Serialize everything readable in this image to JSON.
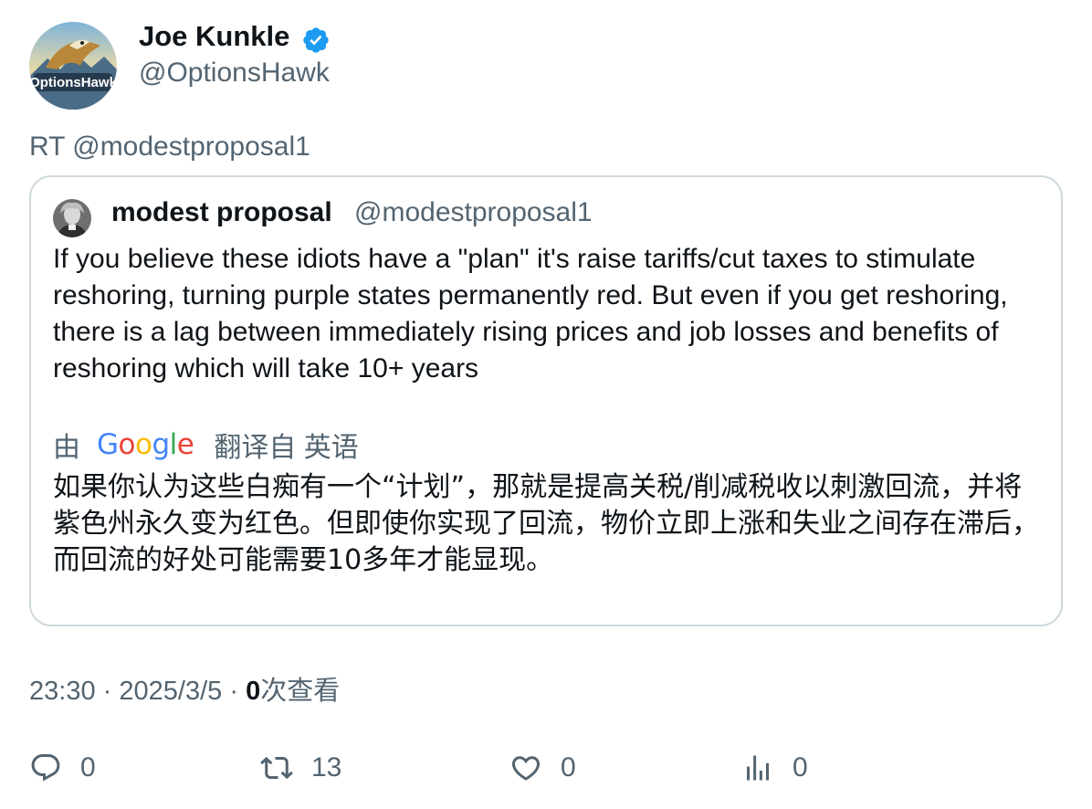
{
  "author": {
    "display_name": "Joe Kunkle",
    "handle": "@OptionsHawk",
    "avatar_text": "OptionsHawk",
    "verified_icon": "verified-badge-icon"
  },
  "retweet_line": "RT @modestproposal1",
  "quoted": {
    "display_name": "modest proposal",
    "handle": "@modestproposal1",
    "text": "If you believe these idiots have a \"plan\" it's raise tariffs/cut taxes to stimulate reshoring, turning purple states permanently red. But even if you get reshoring, there is a lag between immediately rising prices and job losses and benefits of reshoring which will take 10+ years",
    "translation_prefix": "由",
    "translation_brand": "Google",
    "translation_suffix": "翻译自 英语",
    "translated_text": "如果你认为这些白痴有一个“计划”，那就是提高关税/削减税收以刺激回流，并将紫色州永久变为红色。但即使你实现了回流，物价立即上涨和失业之间存在滞后，而回流的好处可能需要10多年才能显现。"
  },
  "meta": {
    "time": "23:30",
    "sep1": "·",
    "date": "2025/3/5",
    "sep2": "·",
    "views_count": "0",
    "views_label": "次查看"
  },
  "actions": {
    "reply_count": "0",
    "retweet_count": "13",
    "like_count": "0",
    "views_count": "0"
  },
  "colors": {
    "text_primary": "#0f1419",
    "text_secondary": "#536471",
    "border": "#cfd9de",
    "verified": "#1d9bf0"
  }
}
